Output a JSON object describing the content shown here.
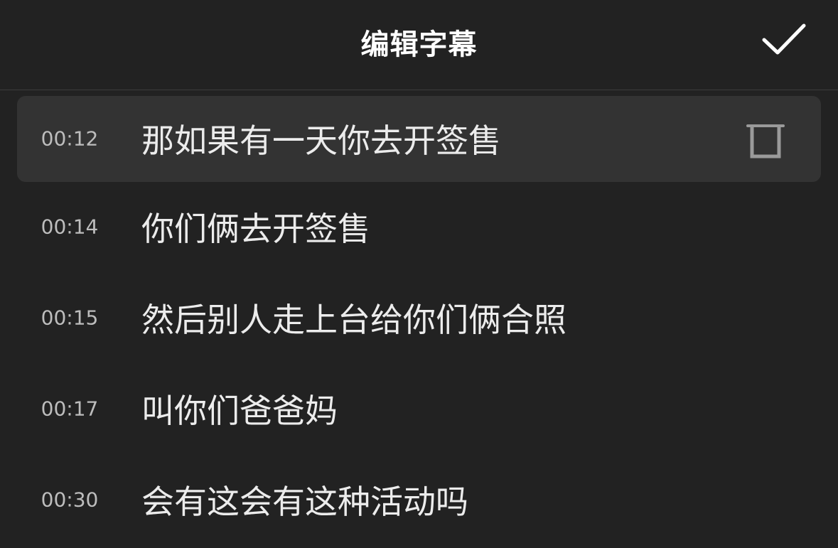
{
  "header": {
    "title": "编辑字幕"
  },
  "subtitles": [
    {
      "time": "00:12",
      "text": "那如果有一天你去开签售",
      "selected": true
    },
    {
      "time": "00:14",
      "text": "你们俩去开签售"
    },
    {
      "time": "00:15",
      "text": "然后别人走上台给你们俩合照"
    },
    {
      "time": "00:17",
      "text": "叫你们爸爸妈"
    },
    {
      "time": "00:30",
      "text": "会有这会有这种活动吗"
    }
  ],
  "icons": {
    "confirm": "checkmark-icon",
    "delete": "trash-icon"
  },
  "colors": {
    "background": "#222222",
    "selected_row": "#333333",
    "text": "#ececec",
    "timestamp": "#bdbdbd"
  }
}
